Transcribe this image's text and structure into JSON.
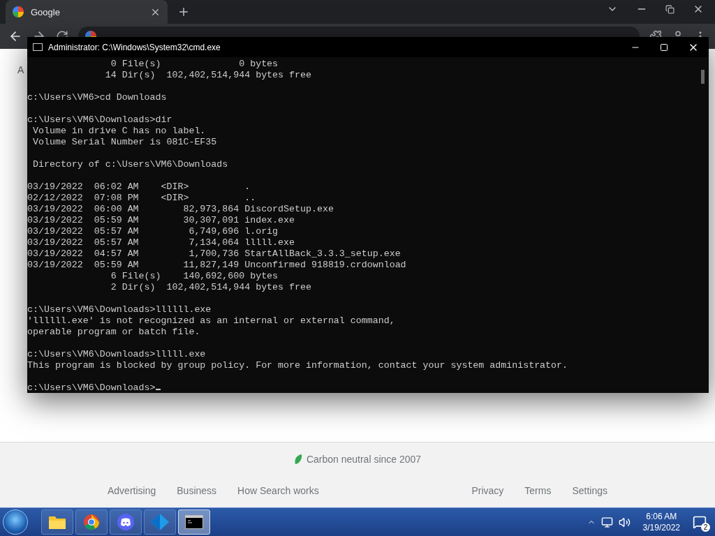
{
  "browser": {
    "tab": {
      "title": "Google",
      "selected": true
    }
  },
  "page": {
    "partial_text": "A",
    "footer_note": "Carbon neutral since 2007",
    "links_left": [
      "Advertising",
      "Business",
      "How Search works"
    ],
    "links_right": [
      "Privacy",
      "Terms",
      "Settings"
    ]
  },
  "console": {
    "title": "Administrator: C:\\Windows\\System32\\cmd.exe",
    "blocks": [
      [
        "               0 File(s)              0 bytes",
        "              14 Dir(s)  102,402,514,944 bytes free"
      ],
      [
        "c:\\Users\\VM6>cd Downloads"
      ],
      [
        "c:\\Users\\VM6\\Downloads>dir",
        " Volume in drive C has no label.",
        " Volume Serial Number is 081C-EF35"
      ],
      [
        " Directory of c:\\Users\\VM6\\Downloads"
      ],
      [
        "03/19/2022  06:02 AM    <DIR>          .",
        "02/12/2022  07:08 PM    <DIR>          ..",
        "03/19/2022  06:00 AM        82,973,864 DiscordSetup.exe",
        "03/19/2022  05:59 AM        30,307,091 index.exe",
        "03/19/2022  05:57 AM         6,749,696 l.orig",
        "03/19/2022  05:57 AM         7,134,064 lllll.exe",
        "03/19/2022  04:57 AM         1,700,736 StartAllBack_3.3.3_setup.exe",
        "03/19/2022  05:59 AM        11,827,149 Unconfirmed 918819.crdownload",
        "               6 File(s)    140,692,600 bytes",
        "               2 Dir(s)  102,402,514,944 bytes free"
      ],
      [
        "c:\\Users\\VM6\\Downloads>llllll.exe",
        "'llllll.exe' is not recognized as an internal or external command,",
        "operable program or batch file."
      ],
      [
        "c:\\Users\\VM6\\Downloads>lllll.exe",
        "This program is blocked by group policy. For more information, contact your system administrator."
      ],
      [
        "c:\\Users\\VM6\\Downloads>"
      ]
    ]
  },
  "taskbar": {
    "apps": [
      {
        "kind": "folder",
        "selected": false
      },
      {
        "kind": "chrome",
        "selected": false
      },
      {
        "kind": "discord",
        "selected": false
      },
      {
        "kind": "diamond",
        "selected": false
      },
      {
        "kind": "console",
        "selected": true
      }
    ],
    "time": "6:06 AM",
    "date": "3/19/2022",
    "notifications": "2"
  }
}
